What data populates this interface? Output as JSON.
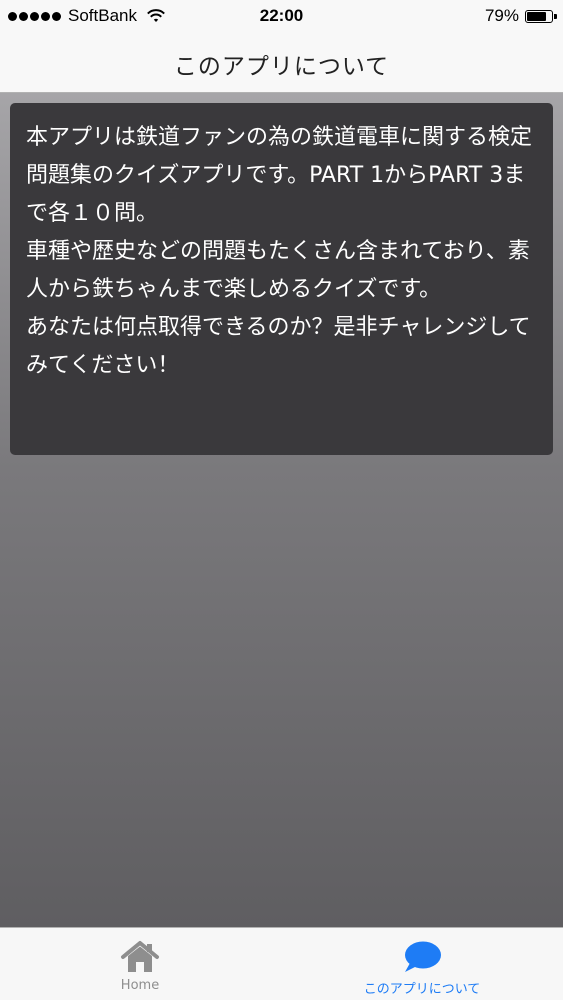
{
  "status_bar": {
    "carrier": "SoftBank",
    "time": "22:00",
    "battery_percent": "79%",
    "battery_level": 0.79,
    "signal_bars": 5
  },
  "nav": {
    "title": "このアプリについて"
  },
  "content": {
    "description": "本アプリは鉄道ファンの為の鉄道電車に関する検定問題集のクイズアプリです。PART 1からPART 3まで各１０問。\n車種や歴史などの問題もたくさん含まれており、素人から鉄ちゃんまで楽しめるクイズです。\nあなたは何点取得できるのか？是非チャレンジしてみてください！"
  },
  "tabs": [
    {
      "label": "Home",
      "icon": "house-icon",
      "selected": false
    },
    {
      "label": "このアプリについて",
      "icon": "speech-bubble-icon",
      "selected": true
    }
  ],
  "colors": {
    "accent": "#1e7cf5",
    "inactive": "#8e8e8e",
    "panel": "#3a393c"
  }
}
